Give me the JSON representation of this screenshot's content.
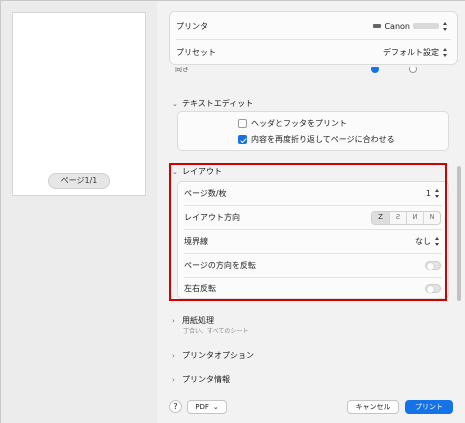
{
  "preview": {
    "page_indicator": "ページ1/1"
  },
  "top": {
    "printer_label": "プリンタ",
    "printer_value": "Canon",
    "preset_label": "プリセット",
    "preset_value": "デフォルト設定"
  },
  "cutoff_row": {
    "label": "向き"
  },
  "text_edit": {
    "title": "テキストエディット",
    "option1": "ヘッダとフッタをプリント",
    "option2": "内容を再度折り返してページに合わせる"
  },
  "layout": {
    "title": "レイアウト",
    "pages_per_sheet_label": "ページ数/枚",
    "pages_per_sheet_value": "1",
    "direction_label": "レイアウト方向",
    "direction_options": [
      "Z",
      "Ƨ",
      "И",
      "N"
    ],
    "border_label": "境界線",
    "border_value": "なし",
    "reverse_orientation_label": "ページの方向を反転",
    "flip_horizontal_label": "左右反転"
  },
  "paper_handling": {
    "title": "用紙処理",
    "subtitle": "丁合い、すべてのシート"
  },
  "printer_options": {
    "title": "プリンタオプション"
  },
  "printer_info": {
    "title": "プリンタ情報"
  },
  "footer": {
    "help": "?",
    "pdf": "PDF",
    "cancel": "キャンセル",
    "print": "プリント"
  },
  "colors": {
    "accent": "#1473e6",
    "highlight": "#d40000"
  }
}
